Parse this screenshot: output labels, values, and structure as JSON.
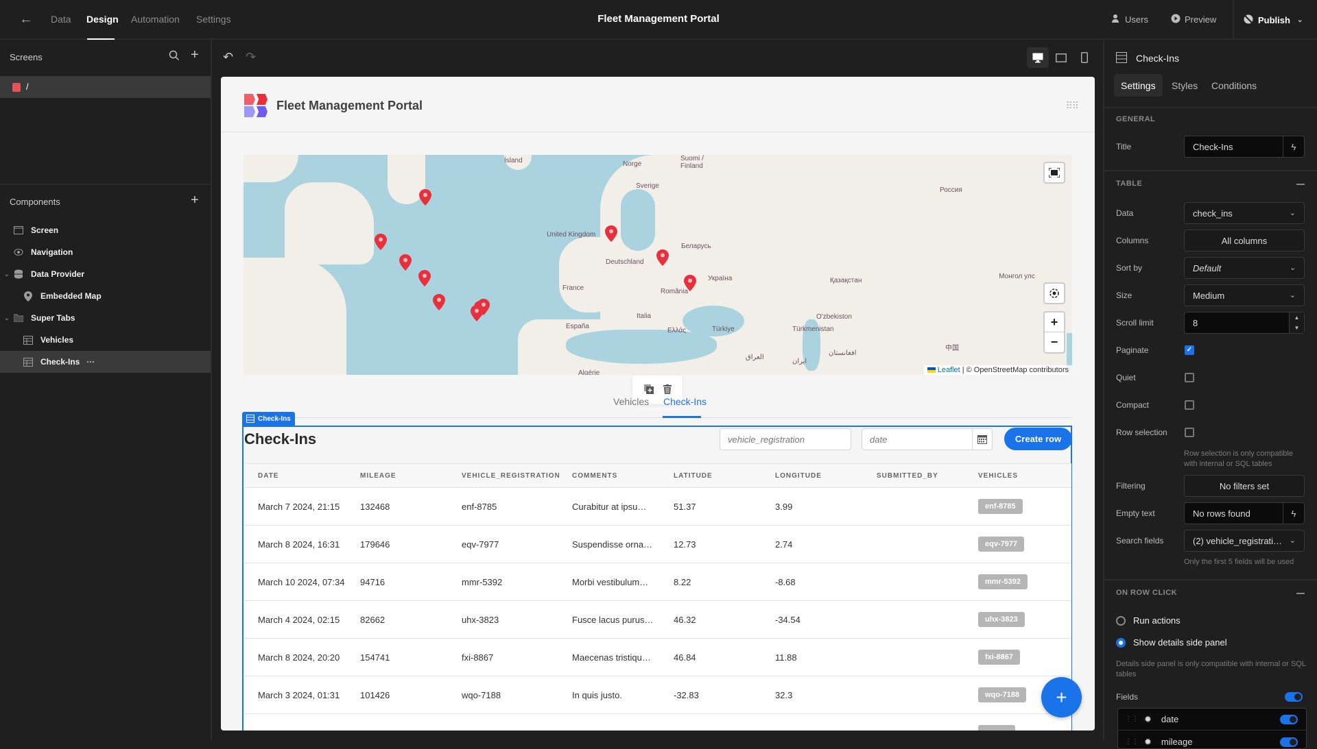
{
  "topbar": {
    "nav_tabs": [
      {
        "label": "Data"
      },
      {
        "label": "Design",
        "active": true
      },
      {
        "label": "Automation"
      },
      {
        "label": "Settings"
      }
    ],
    "app_title": "Fleet Management Portal",
    "actions": {
      "users_label": "Users",
      "preview_label": "Preview",
      "publish_label": "Publish"
    }
  },
  "left_panel": {
    "screens_heading": "Screens",
    "screens": [
      {
        "path": "/",
        "color": "#e5535a"
      }
    ],
    "components_heading": "Components",
    "components": [
      {
        "label": "Screen",
        "icon": "screen-icon"
      },
      {
        "label": "Navigation",
        "icon": "eye-icon"
      },
      {
        "label": "Data Provider",
        "icon": "database-icon",
        "expandable": true
      },
      {
        "label": "Embedded Map",
        "icon": "map-pin-icon"
      },
      {
        "label": "Super Tabs",
        "icon": "folder-icon",
        "expandable": true
      },
      {
        "label": "Vehicles",
        "icon": "table-icon"
      },
      {
        "label": "Check-Ins",
        "icon": "table-icon",
        "selected": true,
        "more": "···"
      }
    ]
  },
  "canvas": {
    "header_title": "Fleet Management Portal",
    "map": {
      "labels": [
        "Ísland",
        "Norge",
        "Suomi / Finland",
        "Sverige",
        "Россия",
        "United Kingdom",
        "Беларусь",
        "Deutschland",
        "France",
        "Україна",
        "România",
        "Қазақстан",
        "Монгол улс",
        "España",
        "Italia",
        "O'zbekiston",
        "Türkmenistan",
        "Ελλάς",
        "Türkiye",
        "中国",
        "العراق",
        "ایران",
        "افغانستان",
        "Algérie"
      ],
      "marker_count": 11,
      "attribution_leaflet": "Leaflet",
      "attribution_rest": "| © OpenStreetMap contributors",
      "zoom_in": "+",
      "zoom_out": "−"
    },
    "tabs": [
      {
        "label": "Vehicles"
      },
      {
        "label": "Check-Ins",
        "active": true
      }
    ],
    "selection_badge": "Check-Ins",
    "table": {
      "title": "Check-Ins",
      "search_placeholder": "vehicle_registration",
      "date_placeholder": "date",
      "create_button": "Create row",
      "columns": [
        "DATE",
        "MILEAGE",
        "VEHICLE_REGISTRATION",
        "COMMENTS",
        "LATITUDE",
        "LONGITUDE",
        "SUBMITTED_BY",
        "VEHICLES"
      ],
      "rows": [
        {
          "date": "March 7 2024, 21:15",
          "mileage": "132468",
          "reg": "enf-8785",
          "comments": "Curabitur at ipsu…",
          "lat": "51.37",
          "lon": "3.99",
          "submitted_by": "",
          "vehicle": "enf-8785"
        },
        {
          "date": "March 8 2024, 16:31",
          "mileage": "179646",
          "reg": "eqv-7977",
          "comments": "Suspendisse orna…",
          "lat": "12.73",
          "lon": "2.74",
          "submitted_by": "",
          "vehicle": "eqv-7977"
        },
        {
          "date": "March 10 2024, 07:34",
          "mileage": "94716",
          "reg": "mmr-5392",
          "comments": "Morbi vestibulum…",
          "lat": "8.22",
          "lon": "-8.68",
          "submitted_by": "",
          "vehicle": "mmr-5392"
        },
        {
          "date": "March 4 2024, 02:15",
          "mileage": "82662",
          "reg": "uhx-3823",
          "comments": "Fusce lacus purus…",
          "lat": "46.32",
          "lon": "-34.54",
          "submitted_by": "",
          "vehicle": "uhx-3823"
        },
        {
          "date": "March 8 2024, 20:20",
          "mileage": "154741",
          "reg": "fxi-8867",
          "comments": "Maecenas tristiqu…",
          "lat": "46.84",
          "lon": "11.88",
          "submitted_by": "",
          "vehicle": "fxi-8867"
        },
        {
          "date": "March 3 2024, 01:31",
          "mileage": "101426",
          "reg": "wqo-7188",
          "comments": "In quis justo.",
          "lat": "-32.83",
          "lon": "32.3",
          "submitted_by": "",
          "vehicle": "wqo-7188"
        }
      ]
    },
    "fab_label": "+"
  },
  "right_panel": {
    "component_title": "Check-Ins",
    "tabs": [
      {
        "label": "Settings",
        "active": true
      },
      {
        "label": "Styles"
      },
      {
        "label": "Conditions"
      }
    ],
    "general": {
      "heading": "GENERAL",
      "title_label": "Title",
      "title_value": "Check-Ins"
    },
    "table": {
      "heading": "TABLE",
      "data_label": "Data",
      "data_value": "check_ins",
      "columns_label": "Columns",
      "columns_value": "All columns",
      "sort_label": "Sort by",
      "sort_value": "Default",
      "size_label": "Size",
      "size_value": "Medium",
      "scroll_label": "Scroll limit",
      "scroll_value": "8",
      "paginate_label": "Paginate",
      "paginate": true,
      "quiet_label": "Quiet",
      "quiet": false,
      "compact_label": "Compact",
      "compact": false,
      "row_selection_label": "Row selection",
      "row_selection": false,
      "row_selection_hint": "Row selection is only compatible with internal or SQL tables",
      "filtering_label": "Filtering",
      "filtering_value": "No filters set",
      "empty_label": "Empty text",
      "empty_value": "No rows found",
      "search_fields_label": "Search fields",
      "search_fields_value": "(2) vehicle_registrati…",
      "search_fields_hint": "Only the first 5 fields will be used"
    },
    "on_row_click": {
      "heading": "ON ROW CLICK",
      "options": [
        {
          "label": "Run actions",
          "selected": false
        },
        {
          "label": "Show details side panel",
          "selected": true
        }
      ],
      "hint": "Details side panel is only compatible with internal or SQL tables",
      "fields_label": "Fields",
      "fields_enabled": true,
      "fields": [
        {
          "name": "date",
          "enabled": true
        },
        {
          "name": "mileage",
          "enabled": true
        }
      ]
    }
  }
}
